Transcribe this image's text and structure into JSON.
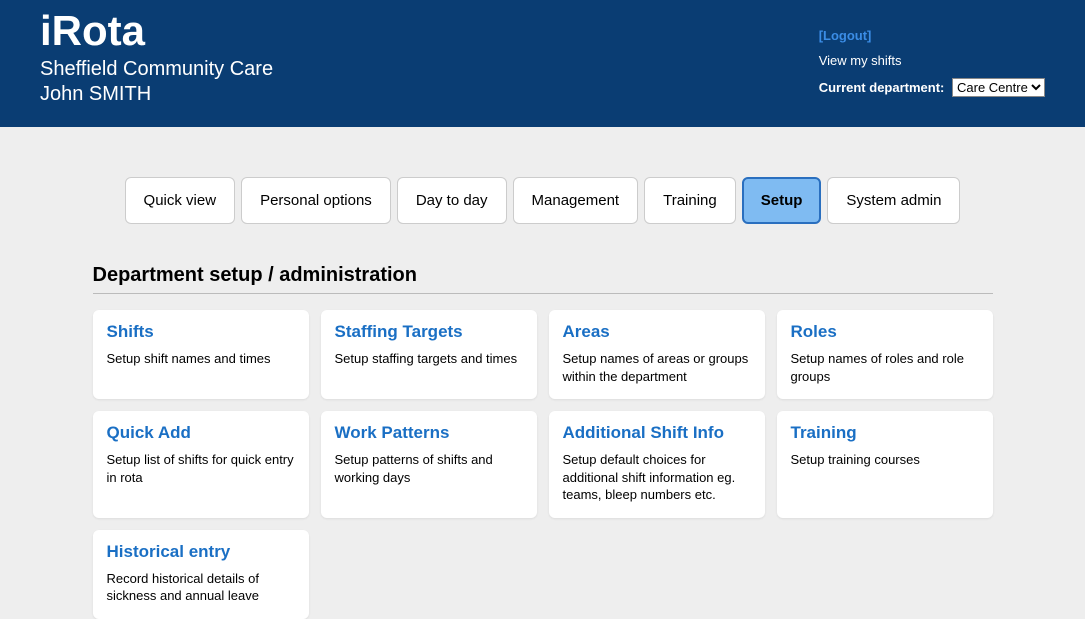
{
  "header": {
    "brand": "iRota",
    "organisation": "Sheffield Community Care",
    "username": "John SMITH",
    "logout": "[Logout]",
    "view_shifts": "View my shifts",
    "dept_label": "Current department:",
    "dept_selected": "Care Centre"
  },
  "tabs": [
    {
      "label": "Quick view",
      "active": false
    },
    {
      "label": "Personal options",
      "active": false
    },
    {
      "label": "Day to day",
      "active": false
    },
    {
      "label": "Management",
      "active": false
    },
    {
      "label": "Training",
      "active": false
    },
    {
      "label": "Setup",
      "active": true
    },
    {
      "label": "System admin",
      "active": false
    }
  ],
  "section_title": "Department setup / administration",
  "cards": [
    {
      "title": "Shifts",
      "desc": "Setup shift names and times"
    },
    {
      "title": "Staffing Targets",
      "desc": "Setup staffing targets and times"
    },
    {
      "title": "Areas",
      "desc": "Setup names of areas or groups within the department"
    },
    {
      "title": "Roles",
      "desc": "Setup names of roles and role groups"
    },
    {
      "title": "Quick Add",
      "desc": "Setup list of shifts for quick entry in rota"
    },
    {
      "title": "Work Patterns",
      "desc": "Setup patterns of shifts and working days"
    },
    {
      "title": "Additional Shift Info",
      "desc": "Setup default choices for additional shift information eg. teams, bleep numbers etc."
    },
    {
      "title": "Training",
      "desc": "Setup training courses"
    },
    {
      "title": "Historical entry",
      "desc": "Record historical details of sickness and annual leave"
    }
  ]
}
